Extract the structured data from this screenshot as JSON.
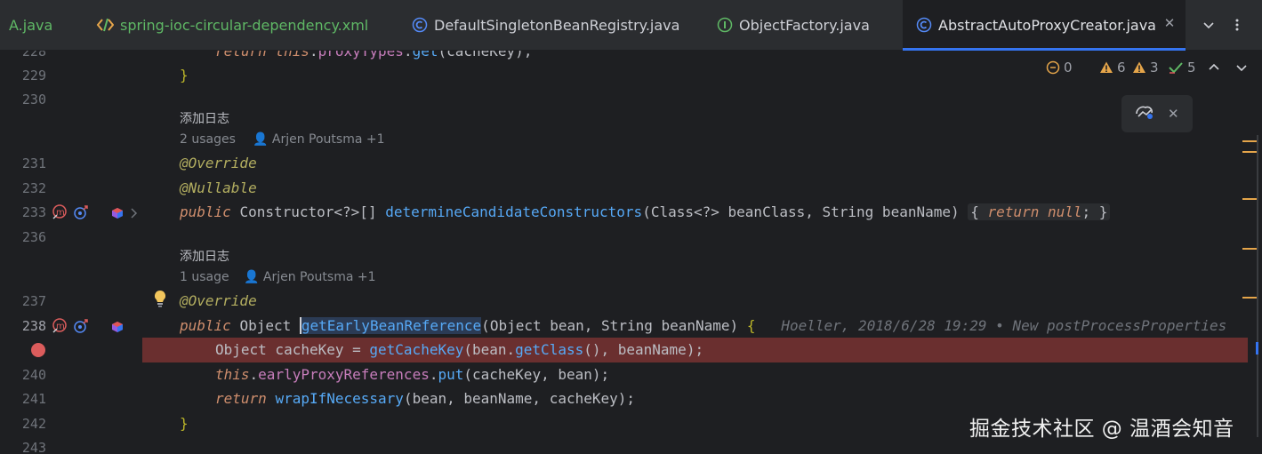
{
  "tabs": [
    {
      "label": "A.java",
      "icon": "java-file-icon",
      "color": "#5fb865"
    },
    {
      "label": "spring-ioc-circular-dependency.xml",
      "icon": "xml-file-icon",
      "color": "#5fb865"
    },
    {
      "label": "DefaultSingletonBeanRegistry.java",
      "icon": "class-icon",
      "color": "#ced0d6"
    },
    {
      "label": "ObjectFactory.java",
      "icon": "interface-icon",
      "color": "#ced0d6"
    },
    {
      "label": "AbstractAutoProxyCreator.java",
      "icon": "class-icon",
      "color": "#dfe1e5",
      "active": true
    }
  ],
  "tab_close": "✕",
  "toolbar": {
    "more_tabs": "chevron-down-icon",
    "options": "kebab-menu-icon"
  },
  "inspections": {
    "weak_warnings": "0",
    "warnings": "6",
    "errors": "3",
    "ok": "5"
  },
  "popup": {
    "icon": "ai-assistant-icon",
    "close": "✕"
  },
  "editor": {
    "line_numbers": {
      "l228": "228",
      "l229": "229",
      "l230": "230",
      "l231": "231",
      "l232": "232",
      "l233": "233",
      "l236": "236",
      "l237": "237",
      "l238": "238",
      "l240": "240",
      "l241": "241",
      "l242": "242",
      "l243": "243"
    },
    "inlays": {
      "log1": "添加日志",
      "usages1": "2 usages",
      "author1": "Arjen Poutsma +1",
      "log2": "添加日志",
      "usages2": "1 usage",
      "author2": "Arjen Poutsma +1"
    },
    "blame": "Hoeller, 2018/6/28 19:29 • New postProcessProperties"
  },
  "watermark": "掘金技术社区 @ 温酒会知音",
  "colors": {
    "accent": "#3574f0",
    "breakpoint": "#db5c5c",
    "breakpoint_line": "#6a2f2f",
    "keyword": "#cf8e6d",
    "method": "#56a8f5",
    "field": "#c77dbb",
    "annotation": "#b3ae60"
  }
}
